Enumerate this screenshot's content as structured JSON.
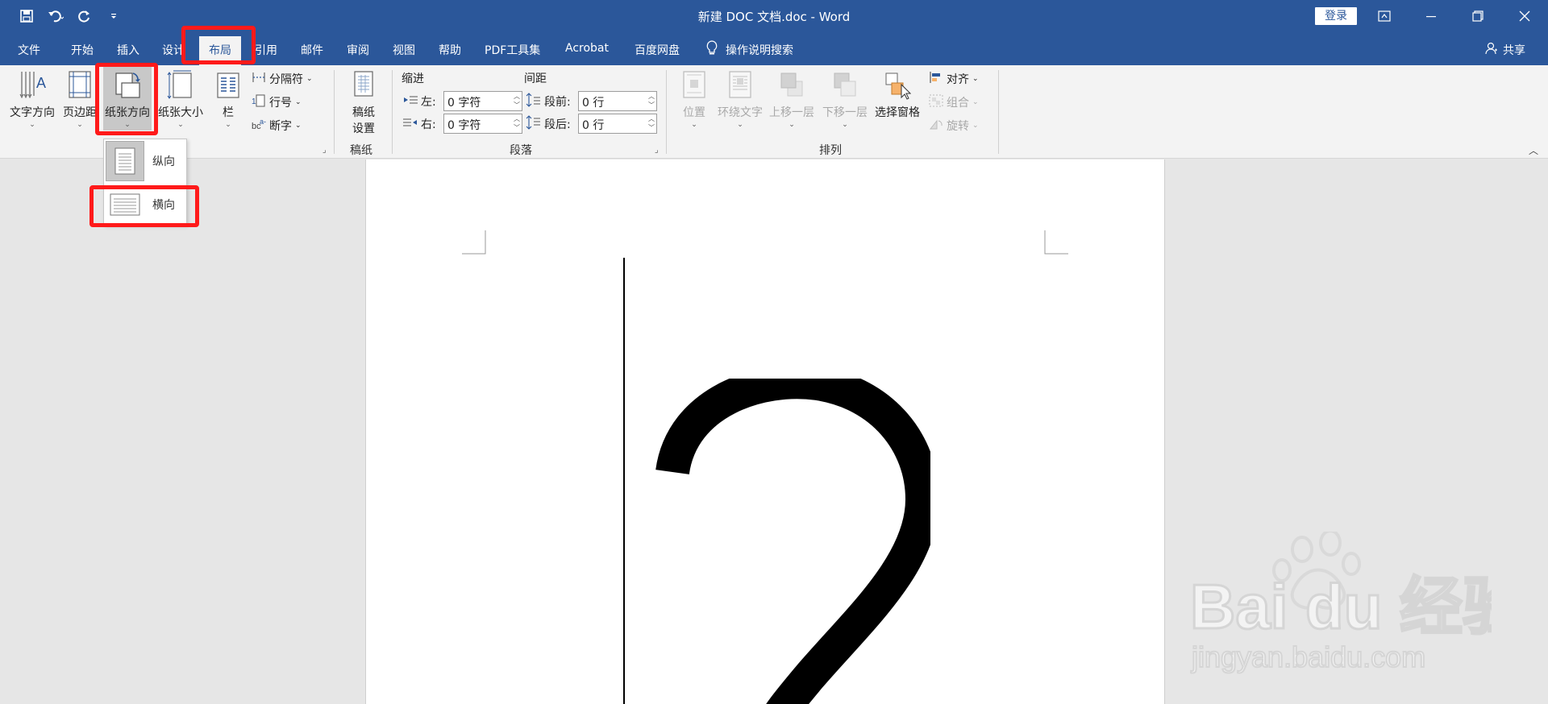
{
  "titlebar": {
    "doc_title": "新建 DOC 文档.doc - Word",
    "login_label": "登录",
    "qat_icons": [
      "save-icon",
      "undo-icon",
      "redo-icon",
      "customize-icon"
    ]
  },
  "tabs": [
    {
      "label": "文件"
    },
    {
      "label": "开始"
    },
    {
      "label": "插入"
    },
    {
      "label": "设计"
    },
    {
      "label": "布局",
      "active": true
    },
    {
      "label": "引用"
    },
    {
      "label": "邮件"
    },
    {
      "label": "审阅"
    },
    {
      "label": "视图"
    },
    {
      "label": "帮助"
    },
    {
      "label": "PDF工具集"
    },
    {
      "label": "Acrobat"
    },
    {
      "label": "百度网盘"
    }
  ],
  "tell_me": "操作说明搜索",
  "share": "共享",
  "ribbon": {
    "page_setup": {
      "text_direction": "文字方向",
      "margins": "页边距",
      "orientation": "纸张方向",
      "size": "纸张大小",
      "columns": "栏",
      "breaks": "分隔符",
      "line_numbers": "行号",
      "hyphenation": "断字"
    },
    "manuscript": {
      "settings_line1": "稿纸",
      "settings_line2": "设置",
      "group": "稿纸"
    },
    "paragraph": {
      "indent_header": "缩进",
      "spacing_header": "间距",
      "left_label": "左:",
      "left_value": "0 字符",
      "right_label": "右:",
      "right_value": "0 字符",
      "before_label": "段前:",
      "before_value": "0 行",
      "after_label": "段后:",
      "after_value": "0 行",
      "group": "段落"
    },
    "arrange": {
      "position": "位置",
      "wrap_text": "环绕文字",
      "bring_forward": "上移一层",
      "send_backward": "下移一层",
      "selection_pane": "选择窗格",
      "align": "对齐",
      "group_btn": "组合",
      "rotate": "旋转",
      "group": "排列"
    }
  },
  "orientation_menu": {
    "portrait": "纵向",
    "landscape": "横向"
  },
  "document": {
    "big_glyph": "2"
  },
  "watermark": {
    "brand": "Bai du 经验",
    "url": "jingyan.baidu.com"
  }
}
